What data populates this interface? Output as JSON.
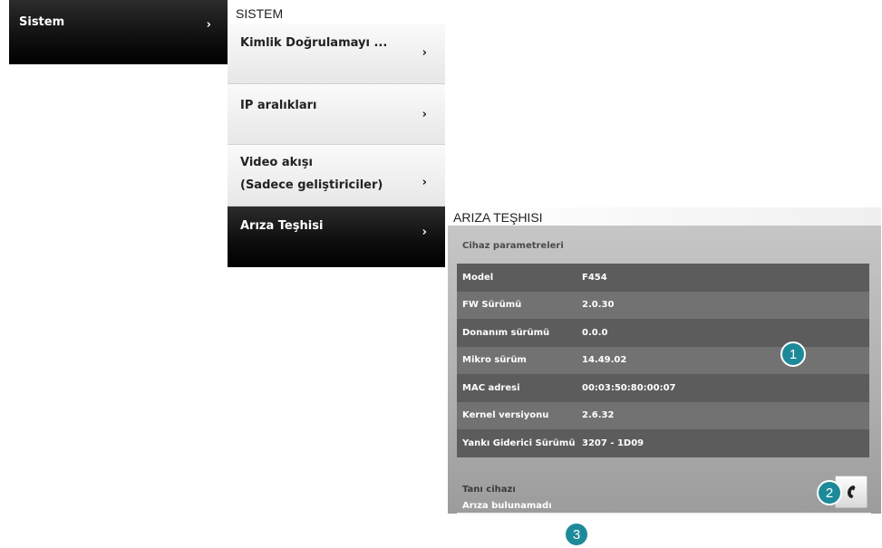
{
  "left_menu": {
    "label": "Sistem",
    "chevron": "›"
  },
  "sistem_menu": {
    "title": "SISTEM",
    "items": [
      {
        "label": "Kimlik Doğrulamayı ...",
        "chevron": "›"
      },
      {
        "label": "IP aralıkları",
        "chevron": "›"
      },
      {
        "label_line1": "Video akışı",
        "label_line2": "(Sadece geliştiriciler)",
        "chevron": "›"
      },
      {
        "label": "Arıza Teşhisi",
        "chevron": "›"
      }
    ]
  },
  "diagnostics": {
    "title": "ARIZA TEŞHISI",
    "section_label": "Cihaz parametreleri",
    "params": [
      {
        "key": "Model",
        "value": "F454"
      },
      {
        "key": "FW Sürümü",
        "value": "2.0.30"
      },
      {
        "key": "Donanım sürümü",
        "value": "0.0.0"
      },
      {
        "key": "Mikro sürüm",
        "value": "14.49.02"
      },
      {
        "key": "MAC adresi",
        "value": "00:03:50:80:00:07"
      },
      {
        "key": "Kernel versiyonu",
        "value": "2.6.32"
      },
      {
        "key": "Yankı Giderici Sürümü",
        "value": "3207 - 1D09"
      }
    ],
    "device_label": "Tanı cihazı",
    "device_status": "Arıza bulunamadı",
    "tool_icon": "phone-handset-icon"
  },
  "callouts": {
    "c1": "1",
    "c2": "2",
    "c3": "3"
  },
  "colors": {
    "callout": "#1d8a99",
    "row_dark": "#5c5c5c",
    "row_light": "#727272",
    "panel": "#b4b4b4"
  }
}
